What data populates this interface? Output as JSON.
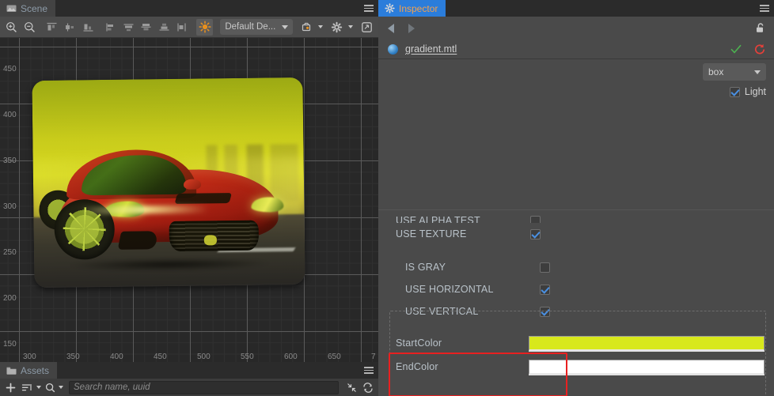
{
  "scene": {
    "tab_label": "Scene",
    "tab_icon": "image-icon",
    "menu_icon": "hamburger-icon",
    "toolbar": {
      "zoom_in_icon": "zoom-in-icon",
      "zoom_out_icon": "zoom-out-icon",
      "align_left_icon": "align-left-icon",
      "align_center_h_icon": "align-center-horizontal-icon",
      "align_right_icon": "align-right-icon",
      "align_top_icon": "align-top-icon",
      "align_middle_icon": "align-middle-icon",
      "distribute_v_icon": "distribute-vertical-icon",
      "align_bottom_icon": "align-bottom-icon",
      "distribute_h_icon": "distribute-horizontal-icon",
      "gizmo_icon": "lighting-gizmo-icon",
      "design_dropdown": "Default De...",
      "camera_icon": "camera-icon",
      "gear_icon": "gear-icon",
      "layout_icon": "layout-icon"
    },
    "ruler_v": [
      "450",
      "400",
      "350",
      "300",
      "250",
      "200",
      "150"
    ],
    "ruler_h": [
      "300",
      "350",
      "400",
      "450",
      "500",
      "550",
      "600",
      "650",
      "7"
    ]
  },
  "assets": {
    "tab_label": "Assets",
    "tab_icon": "folder-icon",
    "menu_icon": "hamburger-icon",
    "add_icon": "plus-icon",
    "sort_icon": "sort-icon",
    "filter_icon": "search-filter-icon",
    "collapse_icon": "collapse-all-icon",
    "refresh_icon": "refresh-icon",
    "search_placeholder": "Search name, uuid"
  },
  "inspector": {
    "tab_label": "Inspector",
    "tab_icon": "gear-icon",
    "menu_icon": "hamburger-icon",
    "back_icon": "arrow-left-icon",
    "forward_icon": "arrow-right-icon",
    "lock_icon": "unlock-icon",
    "asset_name": "gradient.mtl",
    "asset_icon": "material-sphere-icon",
    "apply_icon": "check-icon",
    "revert_icon": "reset-icon",
    "technique_value": "box",
    "light_checkbox": {
      "label": "Light",
      "checked": true
    },
    "properties": [
      {
        "label": "USE ALPHA TEST",
        "checked": false,
        "indent": false,
        "clipped": true
      },
      {
        "label": "USE TEXTURE",
        "checked": true,
        "indent": false,
        "clipped": false
      },
      {
        "label": "IS GRAY",
        "checked": false,
        "indent": true,
        "clipped": false
      },
      {
        "label": "USE HORIZONTAL",
        "checked": true,
        "indent": true,
        "clipped": false
      },
      {
        "label": "USE VERTICAL",
        "checked": true,
        "indent": true,
        "clipped": false
      }
    ],
    "colors": [
      {
        "label": "StartColor",
        "value": "#d8e81c"
      },
      {
        "label": "EndColor",
        "value": "#ffffff"
      }
    ]
  },
  "theme": {
    "accent_blue": "#2b7ddb",
    "tab_text_orange": "#f0a050",
    "highlight_red": "#e82020",
    "checkbox_blue": "#4a90e2",
    "check_green": "#4caf50",
    "revert_red": "#e5403a"
  }
}
